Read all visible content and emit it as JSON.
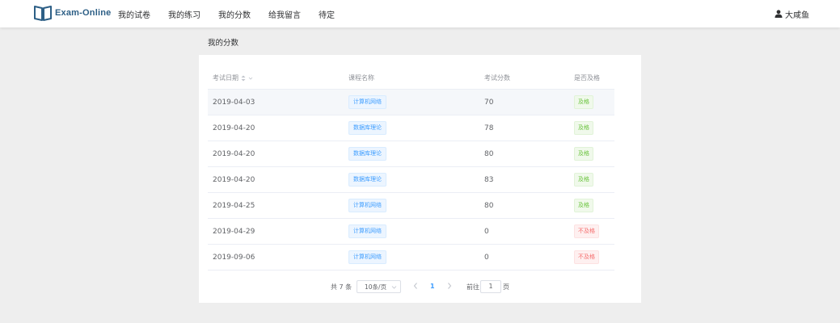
{
  "header": {
    "logo_text": "Exam-Online",
    "nav": [
      "我的试卷",
      "我的练习",
      "我的分数",
      "给我留言",
      "待定"
    ],
    "user_name": "大咸鱼"
  },
  "page_title": "我的分数",
  "table": {
    "columns": [
      "考试日期",
      "课程名称",
      "考试分数",
      "是否及格"
    ],
    "rows": [
      {
        "date": "2019-04-03",
        "course": "计算机网络",
        "score": "70",
        "status": "及格",
        "passed": true
      },
      {
        "date": "2019-04-20",
        "course": "数据库理论",
        "score": "78",
        "status": "及格",
        "passed": true
      },
      {
        "date": "2019-04-20",
        "course": "数据库理论",
        "score": "80",
        "status": "及格",
        "passed": true
      },
      {
        "date": "2019-04-20",
        "course": "数据库理论",
        "score": "83",
        "status": "及格",
        "passed": true
      },
      {
        "date": "2019-04-25",
        "course": "计算机网络",
        "score": "80",
        "status": "及格",
        "passed": true
      },
      {
        "date": "2019-04-29",
        "course": "计算机网络",
        "score": "0",
        "status": "不及格",
        "passed": false
      },
      {
        "date": "2019-09-06",
        "course": "计算机网络",
        "score": "0",
        "status": "不及格",
        "passed": false
      }
    ]
  },
  "pagination": {
    "total_text": "共 7 条",
    "page_size": "10条/页",
    "current_page": "1",
    "goto_label": "前往",
    "goto_value": "1",
    "page_suffix": "页"
  },
  "colors": {
    "primary": "#409eff",
    "success": "#67c23a",
    "danger": "#f56c6c",
    "logo": "#2d5f86"
  },
  "icons": {
    "logo": "open-book-icon",
    "user": "user-icon",
    "sort": "sort-caret-icon",
    "prev": "chevron-left-icon",
    "next": "chevron-right-icon"
  }
}
